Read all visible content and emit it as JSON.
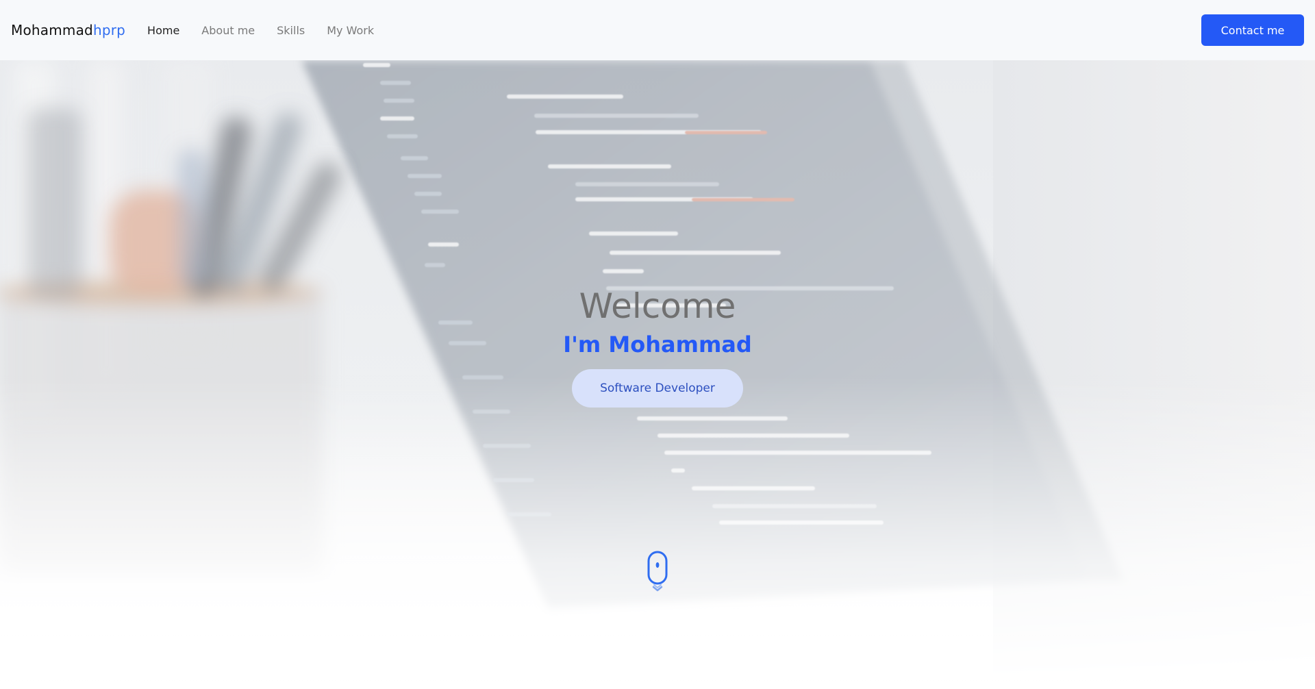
{
  "brand": {
    "name": "Mohammad",
    "accent": "hprp"
  },
  "nav": {
    "items": [
      {
        "label": "Home",
        "active": true
      },
      {
        "label": "About me",
        "active": false
      },
      {
        "label": "Skills",
        "active": false
      },
      {
        "label": "My Work",
        "active": false
      }
    ],
    "contact_label": "Contact me"
  },
  "hero": {
    "welcome": "Welcome",
    "intro": "I'm Mohammad",
    "role": "Software Developer",
    "background": "blurred laptop screen with code and pen holder",
    "scroll_icon": "mouse-scroll-icon"
  },
  "colors": {
    "accent": "#2459f6",
    "navbar_bg": "#f7f9fb",
    "welcome_text": "#707070",
    "pill_bg": "#d8e1fb"
  }
}
